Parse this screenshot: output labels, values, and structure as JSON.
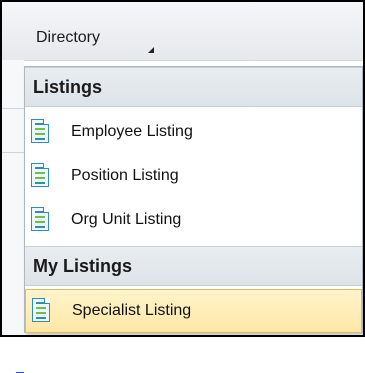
{
  "toolbar": {
    "directory_label": "Directory"
  },
  "menu": {
    "sections": [
      {
        "title": "Listings",
        "items": [
          {
            "label": "Employee Listing",
            "icon": "document-list-icon",
            "selected": false
          },
          {
            "label": "Position Listing",
            "icon": "document-list-icon",
            "selected": false
          },
          {
            "label": "Org Unit Listing",
            "icon": "document-list-icon",
            "selected": false
          }
        ]
      },
      {
        "title": "My Listings",
        "items": [
          {
            "label": "Specialist Listing",
            "icon": "document-list-icon",
            "selected": true
          }
        ]
      }
    ]
  },
  "colors": {
    "selected_bg": "#ffe9a9",
    "selected_border": "#e0bc5a",
    "header_bg": "#e4e9ee",
    "icon_accent": "#2f8fb3"
  }
}
